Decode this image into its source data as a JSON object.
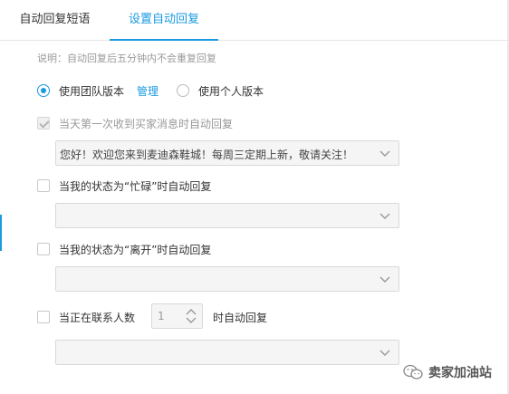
{
  "tabs": [
    {
      "label": "自动回复短语"
    },
    {
      "label": "设置自动回复"
    }
  ],
  "note": "说明：自动回复后五分钟内不会重复回复",
  "version": {
    "team_label": "使用团队版本",
    "manage_link": "管理",
    "personal_label": "使用个人版本",
    "selected": "team"
  },
  "rules": {
    "first_message": {
      "label": "当天第一次收到买家消息时自动回复",
      "checked": true,
      "disabled": true,
      "message": "您好！欢迎您来到麦迪森鞋城！每周三定期上新，敬请关注！"
    },
    "busy": {
      "label": "当我的状态为“忙碌”时自动回复",
      "checked": false,
      "message": ""
    },
    "away": {
      "label": "当我的状态为“离开”时自动回复",
      "checked": false,
      "message": ""
    },
    "contacts": {
      "label_prefix": "当正在联系人数",
      "count": "1",
      "label_suffix": "时自动回复",
      "checked": false,
      "message": ""
    }
  },
  "watermark": {
    "text": "卖家加油站",
    "icon": "wechat-icon"
  },
  "colors": {
    "accent": "#1a9ae0",
    "muted_text": "#999999",
    "field_bg": "#f5f5f5"
  }
}
